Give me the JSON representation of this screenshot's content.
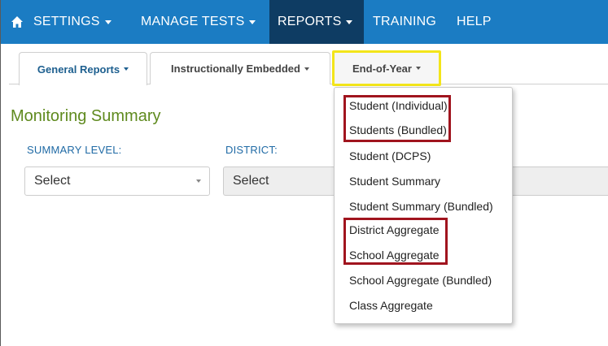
{
  "navbar": {
    "items": [
      {
        "label": "SETTINGS",
        "has_caret": true
      },
      {
        "label": "MANAGE TESTS",
        "has_caret": true
      },
      {
        "label": "REPORTS",
        "has_caret": true,
        "active": true
      },
      {
        "label": "TRAINING",
        "has_caret": false
      },
      {
        "label": "HELP",
        "has_caret": false
      }
    ],
    "home_icon": "home-icon"
  },
  "tabs": [
    {
      "label": "General Reports",
      "active": true
    },
    {
      "label": "Instructionally Embedded",
      "active": false
    },
    {
      "label": "End-of-Year",
      "active": false,
      "highlighted": true
    }
  ],
  "page": {
    "title": "Monitoring Summary",
    "fields": [
      {
        "label": "SUMMARY LEVEL:",
        "value": "Select"
      },
      {
        "label": "DISTRICT:",
        "value": "Select"
      }
    ]
  },
  "dropdown": {
    "items": [
      {
        "label": "Student (Individual)",
        "boxed": true
      },
      {
        "label": "Students (Bundled)",
        "boxed": true
      },
      {
        "label": "Student (DCPS)",
        "boxed": false
      },
      {
        "label": "Student Summary",
        "boxed": false
      },
      {
        "label": "Student Summary (Bundled)",
        "boxed": false
      },
      {
        "label": "District Aggregate",
        "boxed": true
      },
      {
        "label": "School Aggregate",
        "boxed": true
      },
      {
        "label": "School Aggregate (Bundled)",
        "boxed": false
      },
      {
        "label": "Class Aggregate",
        "boxed": false
      }
    ]
  },
  "colors": {
    "navbar": "#1b7cc3",
    "navbar_active": "#0e3c63",
    "title": "#5f8a1e",
    "label": "#1f6aa5",
    "highlight_yellow": "#f3e51a",
    "highlight_red": "#a0141e"
  }
}
